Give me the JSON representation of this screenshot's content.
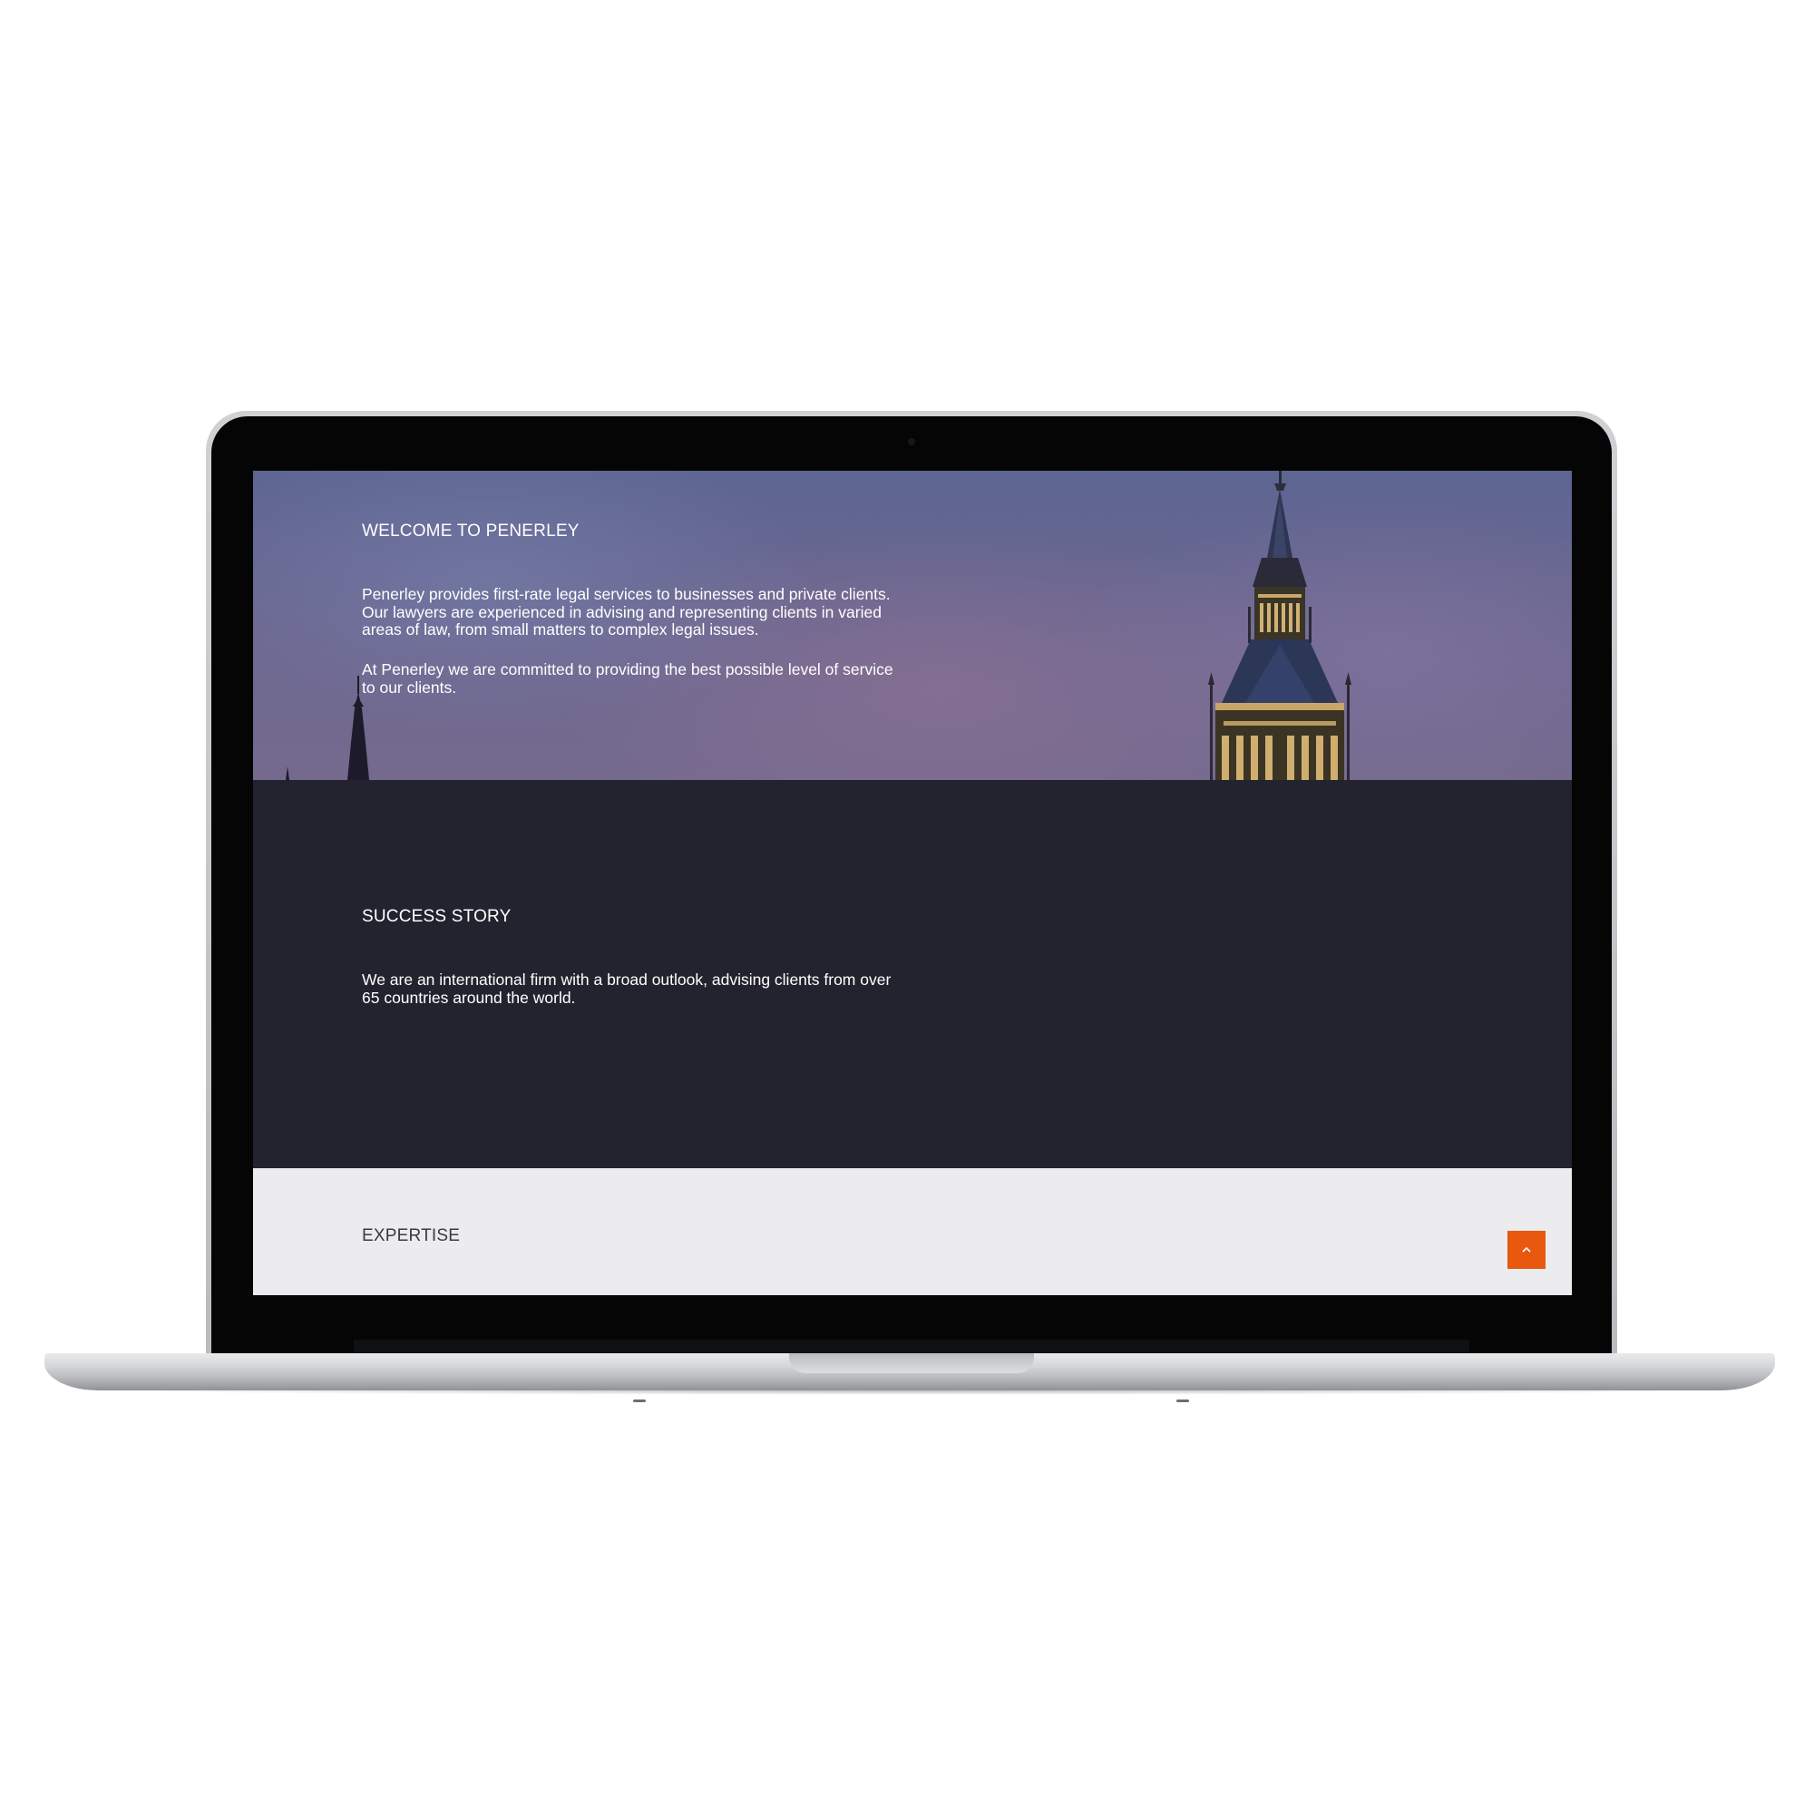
{
  "hero": {
    "title": "WELCOME TO PENERLEY",
    "paragraphs": [
      "Penerley provides first-rate legal services to businesses and private clients. Our lawyers are experienced in advising and representing clients in varied areas of law, from small matters to complex legal issues.",
      "At Penerley we are committed to providing the best possible level of service to our clients."
    ]
  },
  "success": {
    "title": "SUCCESS STORY",
    "text": "We are an international firm with a broad outlook, advising clients from over 65 countries around the world."
  },
  "expertise": {
    "title": "EXPERTISE"
  },
  "scroll_top": {
    "icon": "chevron-up-icon"
  },
  "colors": {
    "accent": "#e8590f",
    "dark_section": "#232330",
    "light_section": "#ececee"
  }
}
